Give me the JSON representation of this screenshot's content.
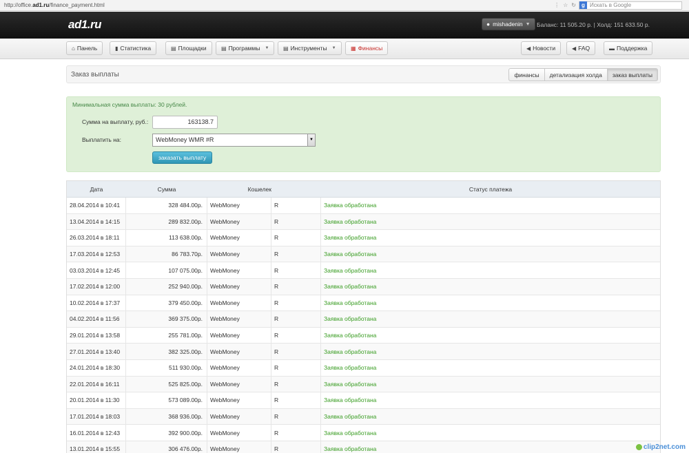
{
  "browser": {
    "url_prefix": "http://office.",
    "url_domain": "ad1.ru",
    "url_path": "/finance_payment.html",
    "search_placeholder": "Искать в Google"
  },
  "header": {
    "logo": "ad1.ru",
    "username": "mishadenin",
    "balance_text": "Баланс: 11 505.20 р.  |  Холд: 151 633.50 р."
  },
  "nav": {
    "panel": "Панель",
    "stats": "Статистика",
    "sites": "Площадки",
    "programs": "Программы",
    "tools": "Инструменты",
    "finance": "Финансы",
    "news": "Новости",
    "faq": "FAQ",
    "support": "Поддержка"
  },
  "page": {
    "title": "Заказ выплаты",
    "tabs": [
      "финансы",
      "детализация холда",
      "заказ выплаты"
    ]
  },
  "form": {
    "note": "Минимальная сумма выплаты: 30 рублей.",
    "amount_label": "Сумма на выплату, руб.:",
    "amount_value": "163138.7",
    "pay_to_label": "Выплатить на:",
    "pay_to_value": "WebMoney WMR #R",
    "submit_label": "заказать выплату"
  },
  "table": {
    "headers": [
      "Дата",
      "Сумма",
      "Кошелек",
      "",
      "Статус платежа"
    ],
    "rows": [
      [
        "28.04.2014 в 10:41",
        "328 484.00р.",
        "WebMoney",
        "R",
        "Заявка обработана"
      ],
      [
        "13.04.2014 в 14:15",
        "289 832.00р.",
        "WebMoney",
        "R",
        "Заявка обработана"
      ],
      [
        "26.03.2014 в 18:11",
        "113 638.00р.",
        "WebMoney",
        "R",
        "Заявка обработана"
      ],
      [
        "17.03.2014 в 12:53",
        "86 783.70р.",
        "WebMoney",
        "R",
        "Заявка обработана"
      ],
      [
        "03.03.2014 в 12:45",
        "107 075.00р.",
        "WebMoney",
        "R",
        "Заявка обработана"
      ],
      [
        "17.02.2014 в 12:00",
        "252 940.00р.",
        "WebMoney",
        "R",
        "Заявка обработана"
      ],
      [
        "10.02.2014 в 17:37",
        "379 450.00р.",
        "WebMoney",
        "R",
        "Заявка обработана"
      ],
      [
        "04.02.2014 в 11:56",
        "369 375.00р.",
        "WebMoney",
        "R",
        "Заявка обработана"
      ],
      [
        "29.01.2014 в 13:58",
        "255 781.00р.",
        "WebMoney",
        "R",
        "Заявка обработана"
      ],
      [
        "27.01.2014 в 13:40",
        "382 325.00р.",
        "WebMoney",
        "R",
        "Заявка обработана"
      ],
      [
        "24.01.2014 в 18:30",
        "511 930.00р.",
        "WebMoney",
        "R",
        "Заявка обработана"
      ],
      [
        "22.01.2014 в 16:11",
        "525 825.00р.",
        "WebMoney",
        "R",
        "Заявка обработана"
      ],
      [
        "20.01.2014 в 11:30",
        "573 089.00р.",
        "WebMoney",
        "R",
        "Заявка обработана"
      ],
      [
        "17.01.2014 в 18:03",
        "368 936.00р.",
        "WebMoney",
        "R",
        "Заявка обработана"
      ],
      [
        "16.01.2014 в 12:43",
        "392 900.00р.",
        "WebMoney",
        "R",
        "Заявка обработана"
      ],
      [
        "13.01.2014 в 15:55",
        "306 476.00р.",
        "WebMoney",
        "R",
        "Заявка обработана"
      ]
    ]
  },
  "watermark": "clip2net.com",
  "colors": {
    "status_green": "#3a9d23",
    "active_red": "#c9302c",
    "button_blue": "#2f96b4",
    "panel_green": "#dff0d8"
  }
}
